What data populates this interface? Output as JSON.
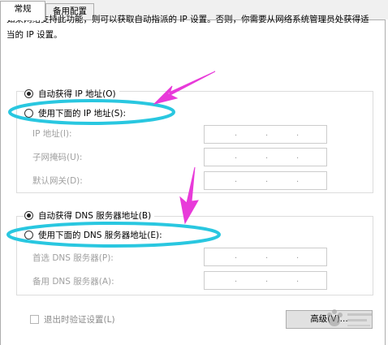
{
  "tabs": [
    {
      "label": "常规",
      "active": true
    },
    {
      "label": "备用配置",
      "active": false
    }
  ],
  "description": "如果网络支持此功能，则可以获取自动指派的 IP 设置。否则，你需要从网络系统管理员处获得适当的 IP 设置。",
  "ip": {
    "auto_label": "自动获得 IP 地址(O)",
    "manual_label": "使用下面的 IP 地址(S):",
    "auto_selected": true,
    "fields": [
      {
        "label": "IP 地址(I):"
      },
      {
        "label": "子网掩码(U):"
      },
      {
        "label": "默认网关(D):"
      }
    ]
  },
  "dns": {
    "auto_label": "自动获得 DNS 服务器地址(B)",
    "manual_label": "使用下面的 DNS 服务器地址(E):",
    "auto_selected": true,
    "fields": [
      {
        "label": "首选 DNS 服务器(P):"
      },
      {
        "label": "备用 DNS 服务器(A):"
      }
    ]
  },
  "validate_label": "退出时验证设置(L)",
  "advanced_label": "高级(V)...",
  "annotation_colors": {
    "arrow": "#e83ad9",
    "highlight": "#29c7e0"
  }
}
